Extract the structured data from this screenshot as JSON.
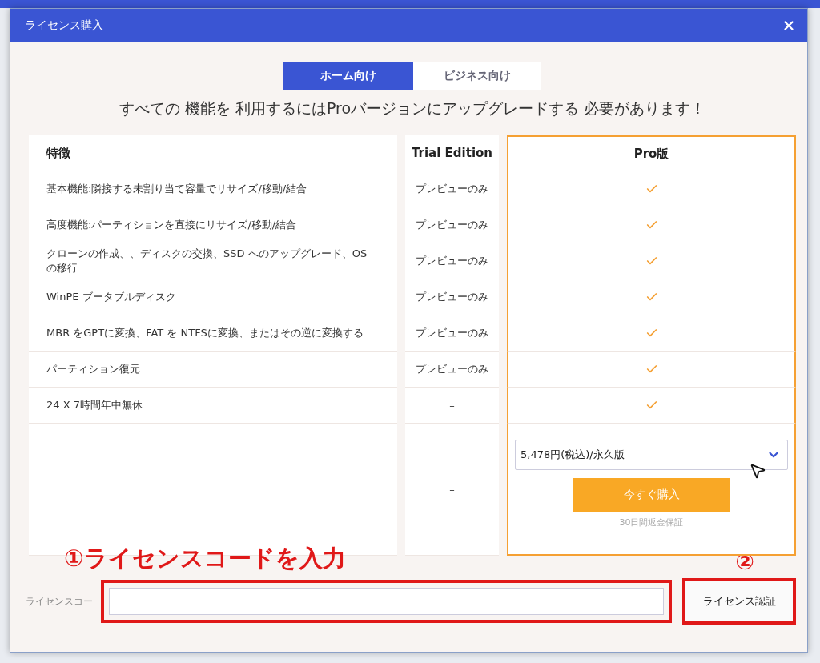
{
  "window": {
    "title": "ライセンス購入"
  },
  "tabs": [
    {
      "label": "ホーム向け",
      "selected": true
    },
    {
      "label": "ビジネス向け",
      "selected": false
    }
  ],
  "headline": "すべての 機能を 利用するにはProバージョンにアップグレードする 必要があります！",
  "table": {
    "columns": [
      "特徴",
      "Trial Edition",
      "Pro版"
    ],
    "rows": [
      {
        "feature": "基本機能:隣接する未割り当て容量でリサイズ/移動/結合",
        "trial": "プレビューのみ",
        "pro_included": true
      },
      {
        "feature": "高度機能:パーティションを直接にリサイズ/移動/結合",
        "trial": "プレビューのみ",
        "pro_included": true
      },
      {
        "feature": "クローンの作成、、ディスクの交換、SSD へのアップグレード、OS の移行",
        "trial": "プレビューのみ",
        "pro_included": true
      },
      {
        "feature": "WinPE ブータブルディスク",
        "trial": "プレビューのみ",
        "pro_included": true
      },
      {
        "feature": "MBR をGPTに変換、FAT を NTFSに変換、またはその逆に変換する",
        "trial": "プレビューのみ",
        "pro_included": true
      },
      {
        "feature": "パーティション復元",
        "trial": "プレビューのみ",
        "pro_included": true
      },
      {
        "feature": "24 X 7時間年中無休",
        "trial": "–",
        "pro_included": true
      }
    ],
    "purchase": {
      "trial": "–",
      "price_option": "5,478円(税込)/永久版",
      "buy_button": "今すぐ購入",
      "guarantee": "30日間返金保証"
    }
  },
  "annotations": {
    "step1": "①ライセンスコードを入力",
    "step2": "②"
  },
  "license": {
    "label": "ライセンスコー",
    "button": "ライセンス認証"
  }
}
